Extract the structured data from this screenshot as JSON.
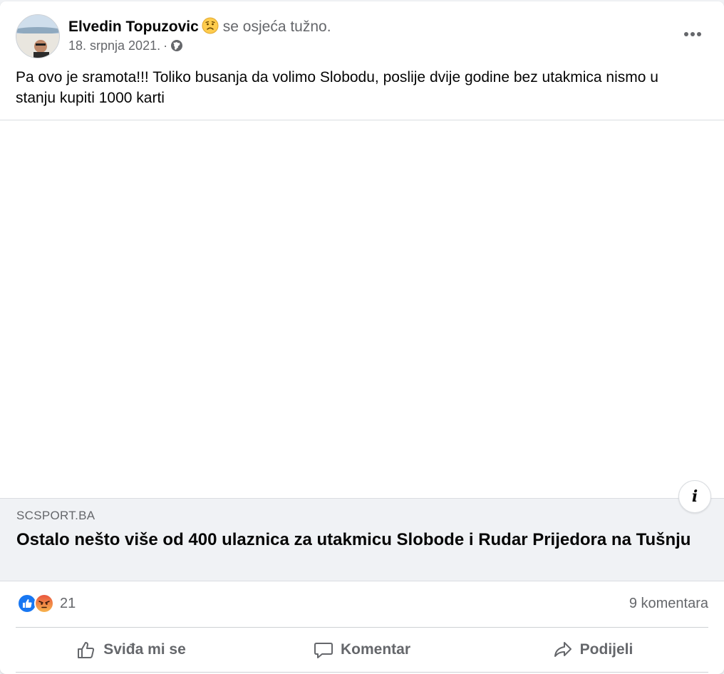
{
  "post": {
    "author": "Elvedin Topuzovic",
    "feeling_text": "se osjeća tužno.",
    "feeling_icon": "sad-face-icon",
    "date": "18. srpnja 2021.",
    "dot": "·",
    "privacy_icon": "globe-icon",
    "text": "Pa ovo je sramota!!! Toliko busanja da volimo Slobodu, poslije dvije godine bez utakmica nismo u stanju kupiti 1000 karti"
  },
  "link": {
    "domain": "SCSPORT.BA",
    "title": "Ostalo nešto više od 400 ulaznica za utakmicu Slobode i Rudar Prijedora na Tušnju",
    "info_label": "i"
  },
  "stats": {
    "reaction_icons": [
      "like-icon",
      "angry-icon"
    ],
    "reaction_count": "21",
    "comments": "9 komentara"
  },
  "actions": {
    "like": "Sviđa mi se",
    "comment": "Komentar",
    "share": "Podijeli"
  },
  "colors": {
    "like_blue": "#1877f2",
    "angry_orange": "#f7714c",
    "secondary_text": "#65676b"
  }
}
